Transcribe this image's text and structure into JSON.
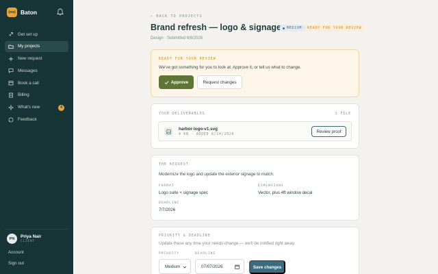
{
  "brand": {
    "logo_text": "(oo)",
    "name": "Baton"
  },
  "nav": {
    "items": [
      {
        "label": "Get set up",
        "icon": "rocket-icon"
      },
      {
        "label": "My projects",
        "icon": "folder-icon",
        "active": true
      },
      {
        "label": "New request",
        "icon": "plus-icon"
      },
      {
        "label": "Messages",
        "icon": "message-icon"
      },
      {
        "label": "Book a call",
        "icon": "calendar-icon"
      },
      {
        "label": "Billing",
        "icon": "billing-icon"
      },
      {
        "label": "What's new",
        "icon": "sparkle-icon",
        "badge": "4"
      },
      {
        "label": "Feedback",
        "icon": "feedback-icon"
      }
    ]
  },
  "user": {
    "initials": "PN",
    "name": "Priya Nair",
    "role": "CLIENT"
  },
  "sidebar_links": {
    "account": "Account",
    "sign_out": "Sign out"
  },
  "header": {
    "back": "← BACK TO PROJECTS",
    "title": "Brand refresh — logo & signage",
    "subtitle": "Design · Submitted 6/8/2026",
    "priority_pill": "MEDIUM",
    "status_pill": "READY FOR YOUR REVIEW"
  },
  "review": {
    "label": "READY FOR YOUR REVIEW",
    "text": "We've got something for you to look at. Approve it, or tell us what to change.",
    "approve": "Approve",
    "request_changes": "Request changes"
  },
  "deliverables": {
    "label": "YOUR DELIVERABLES",
    "count": "1 FILE",
    "file_name": "harbor-logo-v1.svg",
    "file_meta": "4 KB · ADDED 6/14/2026",
    "review_proof": "Review proof"
  },
  "request": {
    "label": "THE REQUEST",
    "text": "Modernize the logo and update the exterior signage to match.",
    "format_label": "FORMAT",
    "format_value": "Logo suite + signage spec",
    "dimensions_label": "DIMENSIONS",
    "dimensions_value": "Vector, plus 4ft window decal",
    "deadline_label": "DEADLINE",
    "deadline_value": "7/7/2026"
  },
  "priority": {
    "label": "PRIORITY & DEADLINE",
    "text": "Update these any time your needs change — we'll be notified right away.",
    "priority_label": "PRIORITY",
    "priority_value": "Medium",
    "deadline_label": "DEADLINE",
    "deadline_value": "07/07/2026",
    "save": "Save changes"
  },
  "colors": {
    "sidebar": "#173536",
    "accent": "#e8a63a",
    "approve": "#5e7535",
    "save": "#3a6b7e"
  }
}
